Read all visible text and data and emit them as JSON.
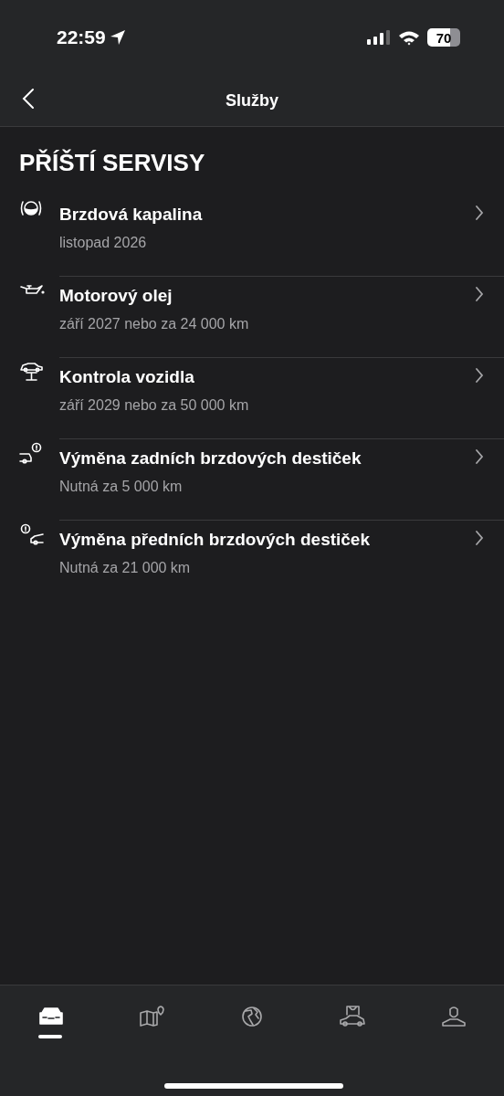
{
  "status_bar": {
    "time": "22:59",
    "battery": "70"
  },
  "nav": {
    "title": "Služby"
  },
  "section_title": "PŘÍŠTÍ SERVISY",
  "services": [
    {
      "kind": "brake-fluid",
      "title": "Brzdová kapalina",
      "subtitle": "listopad 2026"
    },
    {
      "kind": "oil",
      "title": "Motorový olej",
      "subtitle": "září 2027 nebo za 24 000 km"
    },
    {
      "kind": "lift",
      "title": "Kontrola vozidla",
      "subtitle": "září 2029 nebo za 50 000 km"
    },
    {
      "kind": "rear-pads",
      "title": "Výměna zadních brzdových destiček",
      "subtitle": "Nutná za 5 000 km"
    },
    {
      "kind": "front-pads",
      "title": "Výměna předních brzdových destiček",
      "subtitle": "Nutná za 21 000 km"
    }
  ],
  "tabs": [
    {
      "kind": "car",
      "selected": true
    },
    {
      "kind": "map",
      "selected": false
    },
    {
      "kind": "globe",
      "selected": false
    },
    {
      "kind": "shop",
      "selected": false
    },
    {
      "kind": "profile",
      "selected": false
    }
  ]
}
